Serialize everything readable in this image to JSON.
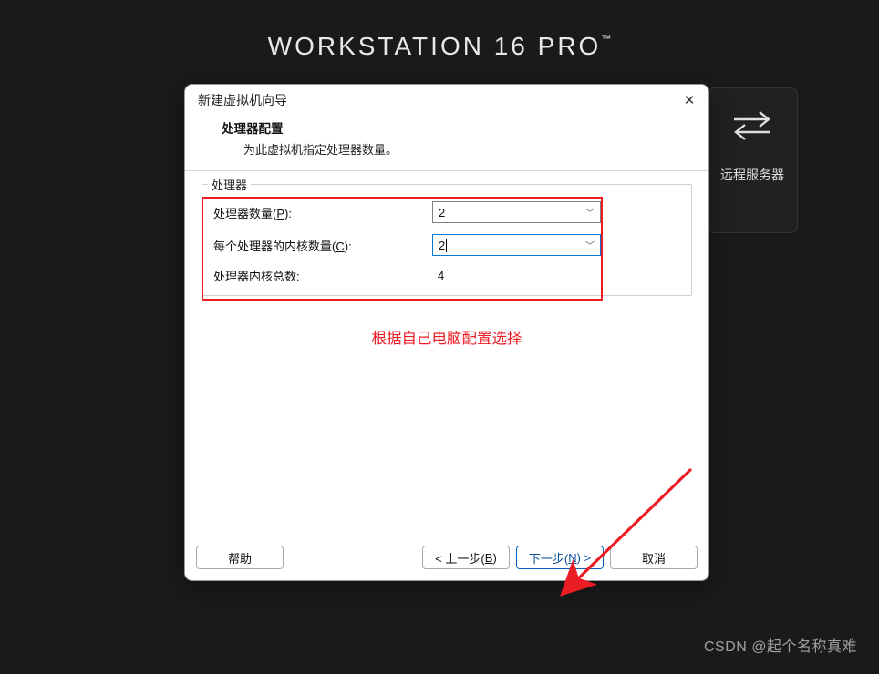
{
  "branding": {
    "line1_bold": "WORKSTATION 16",
    "line1_light": " PRO",
    "tm": "™"
  },
  "bg_tile": {
    "label": "远程服务器"
  },
  "dialog": {
    "title": "新建虚拟机向导",
    "close_glyph": "✕",
    "header_title": "处理器配置",
    "header_sub": "为此虚拟机指定处理器数量。",
    "group_label": "处理器",
    "rows": {
      "processors": {
        "label_pre": "处理器数量(",
        "label_hotkey": "P",
        "label_post": "):",
        "value": "2"
      },
      "cores": {
        "label_pre": "每个处理器的内核数量(",
        "label_hotkey": "C",
        "label_post": "):",
        "value": "2"
      },
      "total": {
        "label": "处理器内核总数:",
        "value": "4"
      }
    },
    "hint": "根据自己电脑配置选择",
    "buttons": {
      "help": "帮助",
      "back_pre": "< 上一步(",
      "back_hotkey": "B",
      "back_post": ")",
      "next_pre": "下一步(",
      "next_hotkey": "N",
      "next_post": ") >",
      "cancel": "取消"
    }
  },
  "watermark": "CSDN @起个名称真难"
}
